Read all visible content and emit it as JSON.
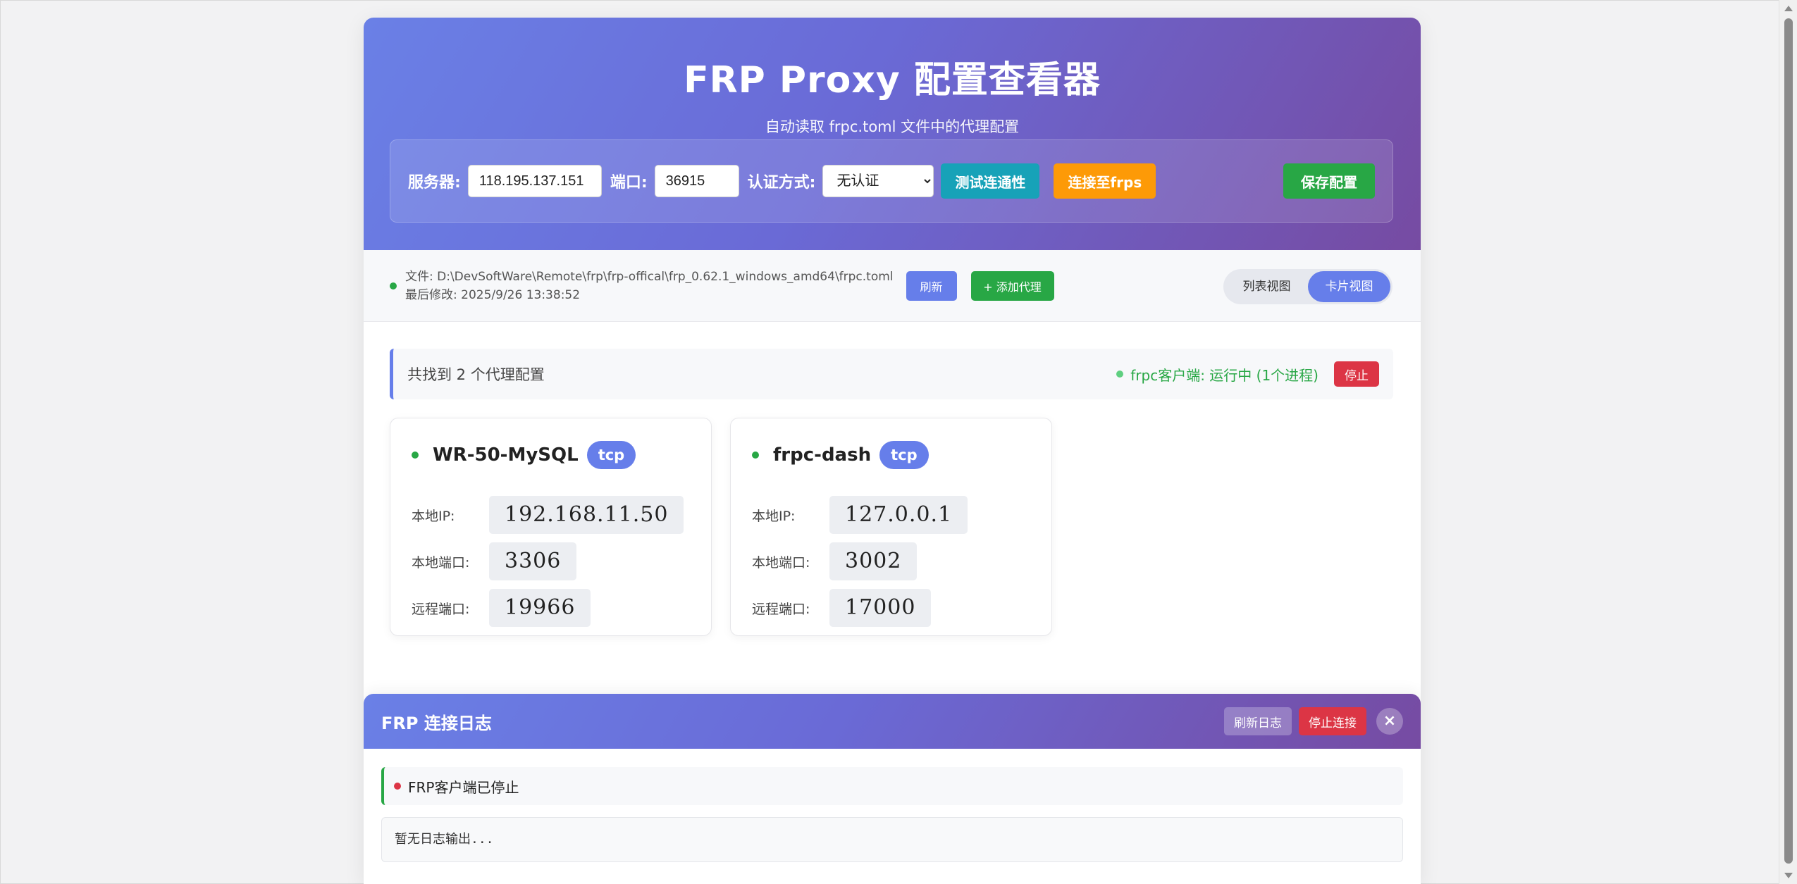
{
  "header": {
    "title": "FRP Proxy 配置查看器",
    "subtitle": "自动读取 frpc.toml 文件中的代理配置",
    "server_label": "服务器:",
    "server_value": "118.195.137.151",
    "port_label": "端口:",
    "port_value": "36915",
    "auth_label": "认证方式:",
    "auth_value": "无认证",
    "test_btn": "测试连通性",
    "connect_btn": "连接至frps",
    "save_btn": "保存配置"
  },
  "toolbar": {
    "file_path": "文件: D:\\DevSoftWare\\Remote\\frp\\frp-offical\\frp_0.62.1_windows_amd64\\frpc.toml",
    "last_modified": "最后修改: 2025/9/26 13:38:52",
    "refresh_btn": "刷新",
    "add_btn": "+ 添加代理",
    "view_list": "列表视图",
    "view_card": "卡片视图"
  },
  "summary": {
    "count_text": "共找到 2 个代理配置",
    "client_status": "frpc客户端: 运行中 (1个进程)",
    "stop_btn": "停止"
  },
  "proxies": [
    {
      "name": "WR-50-MySQL",
      "type": "tcp",
      "local_ip_label": "本地IP:",
      "local_ip": "192.168.11.50",
      "local_port_label": "本地端口:",
      "local_port": "3306",
      "remote_port_label": "远程端口:",
      "remote_port": "19966"
    },
    {
      "name": "frpc-dash",
      "type": "tcp",
      "local_ip_label": "本地IP:",
      "local_ip": "127.0.0.1",
      "local_port_label": "本地端口:",
      "local_port": "3002",
      "remote_port_label": "远程端口:",
      "remote_port": "17000"
    }
  ],
  "log": {
    "title": "FRP 连接日志",
    "refresh_btn": "刷新日志",
    "stop_btn": "停止连接",
    "close_icon": "×",
    "status": "FRP客户端已停止",
    "output": "暂无日志输出..."
  },
  "colors": {
    "accent": "#667eea",
    "gradient_end": "#764ba2",
    "success": "#28a745",
    "danger": "#dc3545",
    "info": "#17a2b8",
    "warning": "#fd9a07"
  }
}
